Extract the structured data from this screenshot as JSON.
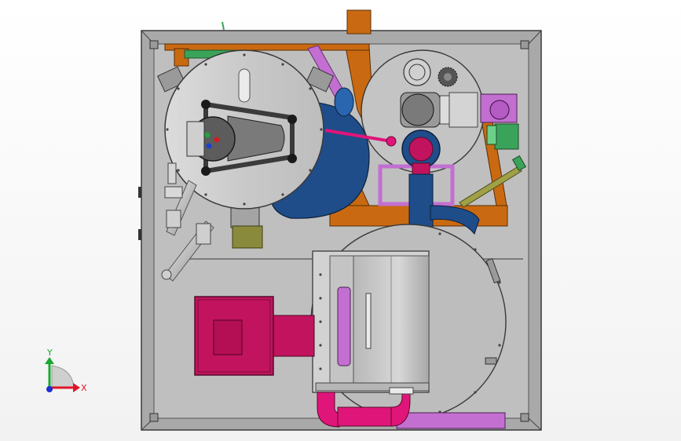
{
  "viewport": {
    "background": "#f4f4f4",
    "frame_color": "#a9a9a9",
    "frame_edge": "#3a3a3a"
  },
  "triad": {
    "x_label": "X",
    "y_label": "Y",
    "x_color": "#e0152a",
    "y_color": "#19a832",
    "origin_color": "#1a2fd6"
  },
  "colors": {
    "orange": "#c96a12",
    "blue": "#1f4d8a",
    "magenta": "#c2145e",
    "pink": "#e0157a",
    "lilac": "#c26fd1",
    "olive": "#8a8a3c",
    "green": "#3aa35a",
    "steel": "#b9b9b9",
    "dark_steel": "#6e6e6e"
  }
}
